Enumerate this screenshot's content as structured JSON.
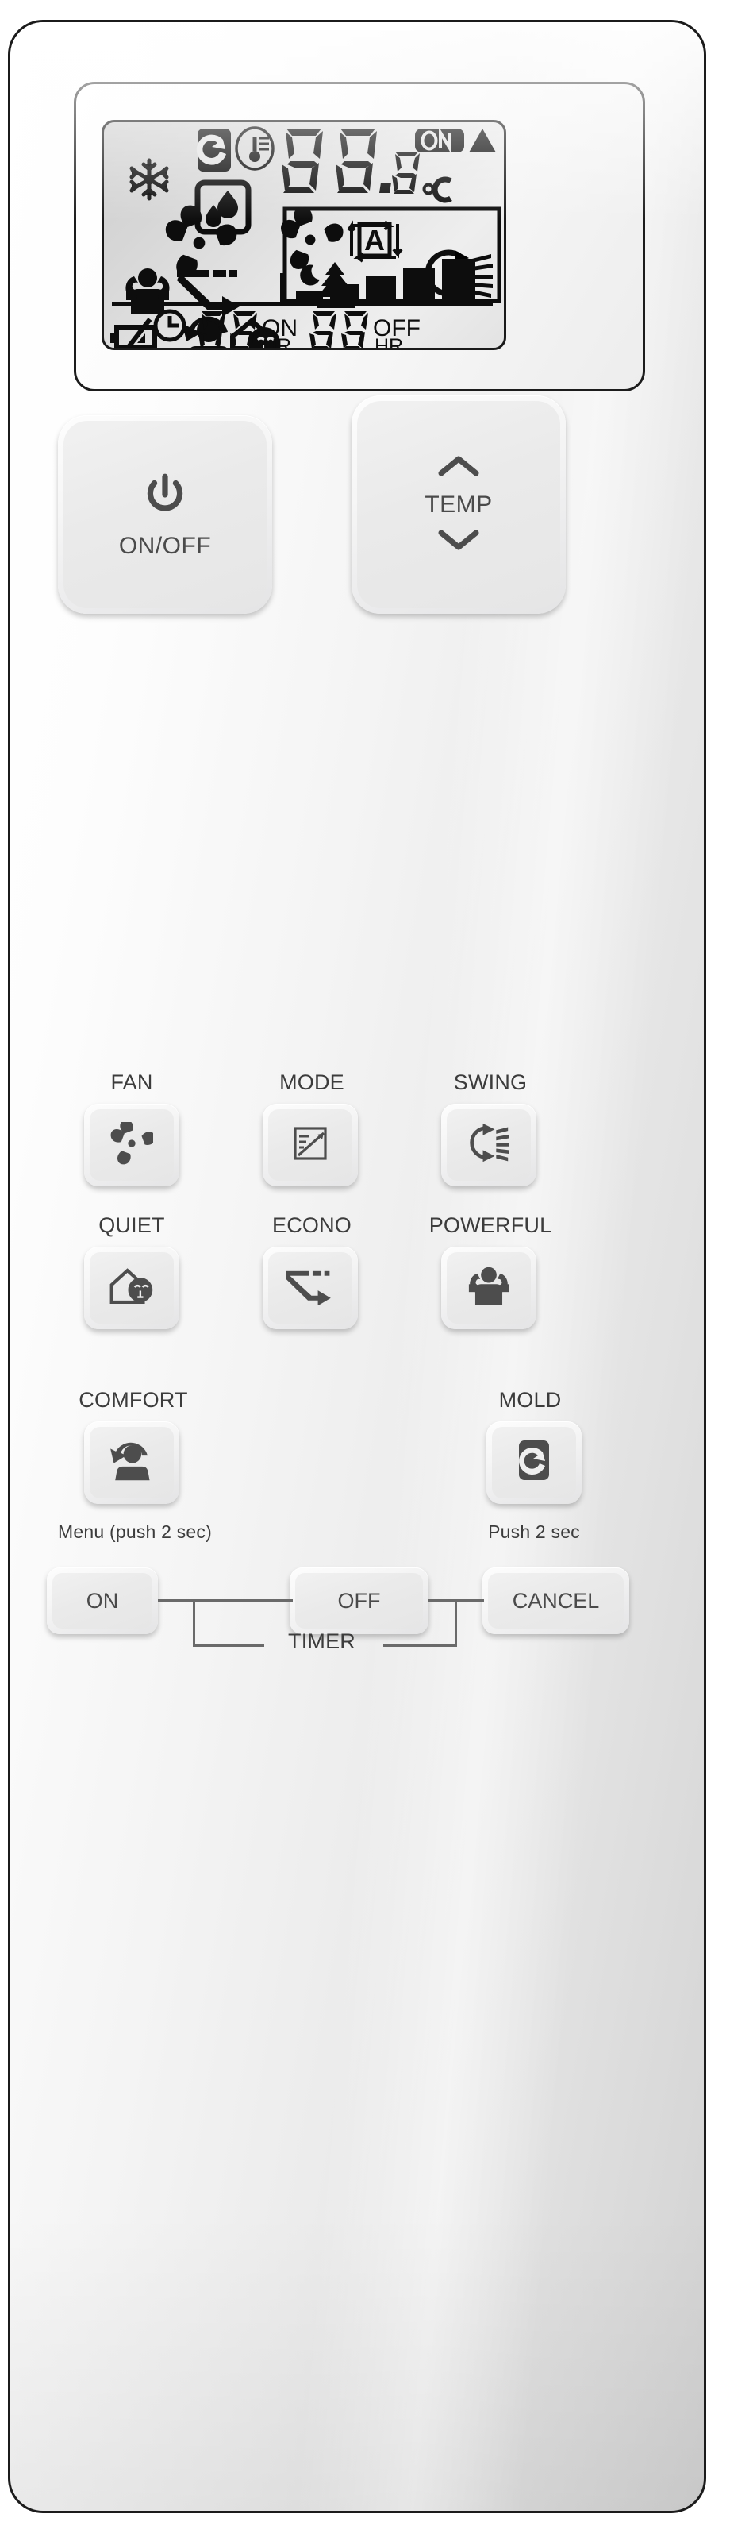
{
  "device": {
    "type": "air-conditioner-remote-control",
    "body_color": "#f1f1f1",
    "outline_color": "#1b1b1b"
  },
  "display": {
    "lcd_background": "#e3e3e3",
    "segment_color": "#0d0d0d",
    "main_temperature": "88.8",
    "temperature_unit": "°C",
    "on_badge": "ON",
    "up_arrow": "▲",
    "mode_auto_letter": "A",
    "icons": {
      "mold_proof": "mold-icon",
      "thermometer": "thermometer-icon",
      "snowflake": "snowflake-cool-icon",
      "dry_drops": "dry-drops-icon",
      "fan_left": "fan-icon",
      "powerful": "powerful-muscle-icon",
      "econo": "econo-arrow-icon",
      "comfort": "comfort-person-icon",
      "quiet_home": "quiet-home-icon",
      "fan_panel": "fan-icon",
      "auto_letter_box": "auto-a-icon",
      "night_tree": "night-set-tree-icon",
      "swing": "swing-icon",
      "fan_bars": "fan-speed-bars",
      "clock": "clock-icon",
      "battery_low": "battery-low-icon"
    },
    "fan_speed_bars": [
      1,
      2,
      3,
      4,
      5
    ],
    "timer": {
      "on_value": "88",
      "on_label": "ON",
      "on_unit": "HR.",
      "off_value": "88",
      "off_label": "OFF",
      "off_unit": "HR."
    }
  },
  "controls": {
    "power": {
      "label": "ON/OFF",
      "icon": "power-icon"
    },
    "temp": {
      "label": "TEMP",
      "up_icon": "chevron-up-icon",
      "down_icon": "chevron-down-icon"
    },
    "row1": [
      {
        "label": "FAN",
        "icon": "fan-icon"
      },
      {
        "label": "MODE",
        "icon": "mode-icon"
      },
      {
        "label": "SWING",
        "icon": "swing-icon"
      }
    ],
    "row2": [
      {
        "label": "QUIET",
        "icon": "quiet-home-icon"
      },
      {
        "label": "ECONO",
        "icon": "econo-arrow-icon"
      },
      {
        "label": "POWERFUL",
        "icon": "powerful-muscle-icon"
      }
    ],
    "row3": [
      {
        "label": "COMFORT",
        "icon": "comfort-person-icon",
        "sub": "Menu (push 2 sec)"
      },
      {
        "label": "MOLD",
        "icon": "mold-icon",
        "sub": "Push 2 sec"
      }
    ],
    "timer_row": {
      "group_label": "TIMER",
      "buttons": [
        {
          "label": "ON"
        },
        {
          "label": "OFF"
        },
        {
          "label": "CANCEL"
        }
      ]
    }
  }
}
